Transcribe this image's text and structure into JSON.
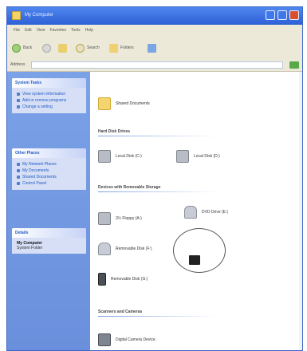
{
  "window": {
    "title": "My Computer",
    "menu": [
      "File",
      "Edit",
      "View",
      "Favorites",
      "Tools",
      "Help"
    ],
    "toolbar": {
      "back_label": "Back",
      "forward_label": "",
      "up_label": "",
      "search_label": "Search",
      "folders_label": "Folders",
      "views_label": ""
    },
    "address": {
      "label": "Address",
      "value": ""
    }
  },
  "taskpane": {
    "system_tasks": {
      "header": "System Tasks",
      "items": [
        "View system information",
        "Add or remove programs",
        "Change a setting"
      ]
    },
    "other_places": {
      "header": "Other Places",
      "items": [
        "My Network Places",
        "My Documents",
        "Shared Documents",
        "Control Panel"
      ]
    },
    "details": {
      "header": "Details",
      "title": "My Computer",
      "subtitle": "System Folder"
    }
  },
  "content": {
    "shared_docs": {
      "label": "Shared Documents"
    },
    "groups": [
      {
        "title": "Hard Disk Drives"
      },
      {
        "title": "Devices with Removable Storage"
      },
      {
        "title": "Scanners and Cameras"
      }
    ],
    "hard_disks": [
      {
        "label": "Local Disk (C:)"
      },
      {
        "label": "Local Disk (D:)"
      }
    ],
    "removable": [
      {
        "label": "3½ Floppy (A:)"
      },
      {
        "label": "DVD Drive (E:)"
      },
      {
        "label": "Removable Disk (F:)"
      },
      {
        "label": "Removable Disk (G:)"
      }
    ],
    "scanners": [
      {
        "label": "Digital Camera Device"
      }
    ]
  }
}
